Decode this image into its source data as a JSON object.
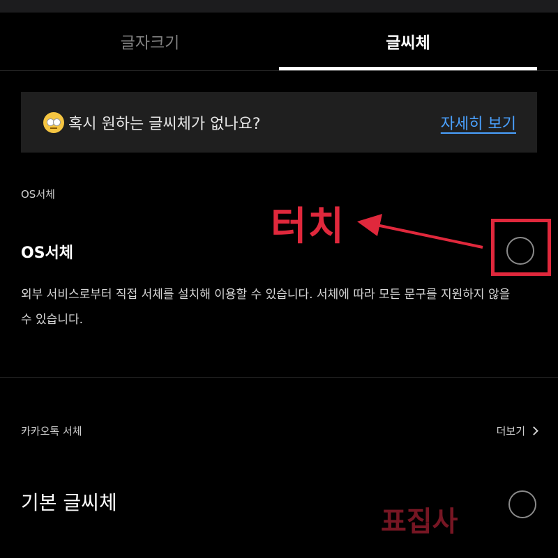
{
  "tabs": [
    {
      "label": "글자크기"
    },
    {
      "label": "글씨체"
    }
  ],
  "banner": {
    "text": "혹시 원하는 글씨체가 없나요?",
    "link": "자세히 보기"
  },
  "os_section": {
    "label": "OS서체",
    "item_title": "OS서체",
    "description": "외부 서비스로부터 직접 서체를 설치해 이용할 수 있습니다. 서체에 따라 모든 문구를 지원하지 않을 수 있습니다."
  },
  "annotation": {
    "text": "터치",
    "color": "#e0283c"
  },
  "kakao_section": {
    "label": "카카오톡 서체",
    "more": "더보기",
    "item_title": "기본 글씨체"
  },
  "watermark": "표집사",
  "icons": {
    "emoji": "rolling-eyes-emoji",
    "chevron": "chevron-right-icon"
  }
}
